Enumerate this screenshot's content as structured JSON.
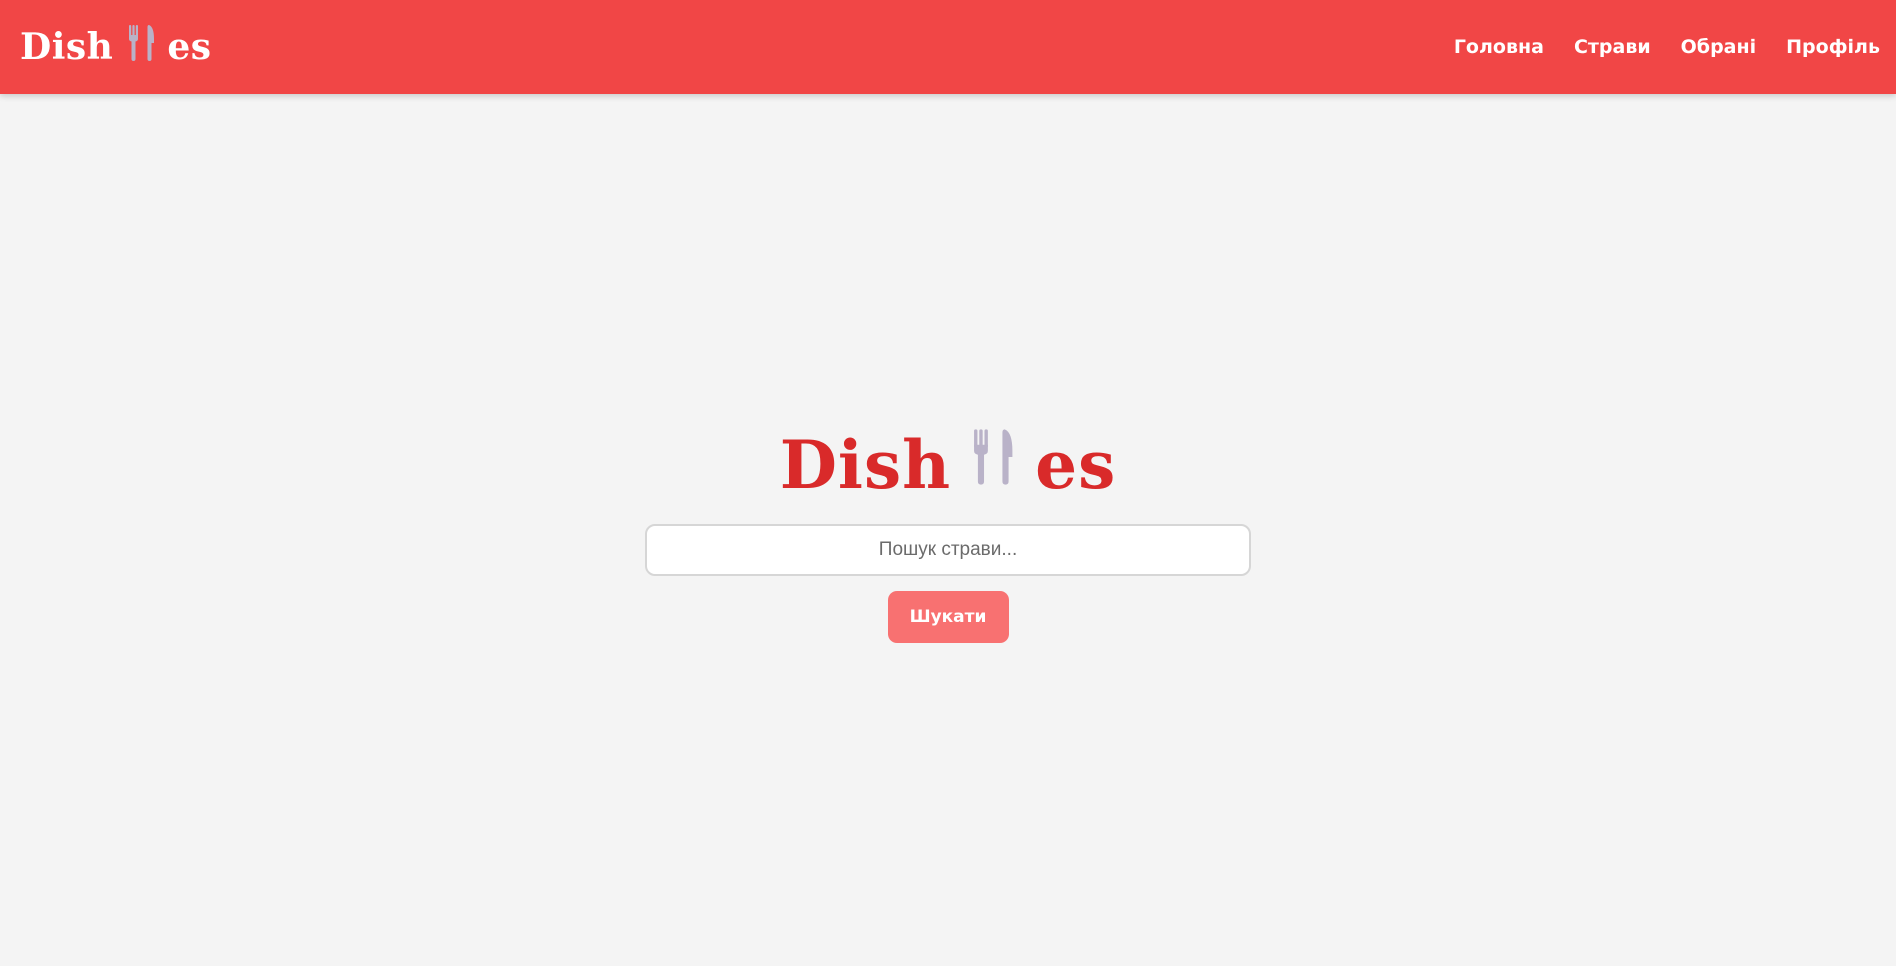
{
  "brand": {
    "prefix": "Dish",
    "suffix": "es",
    "icon": "fork-and-knife-icon"
  },
  "nav": {
    "items": [
      {
        "label": "Головна"
      },
      {
        "label": "Страви"
      },
      {
        "label": "Обрані"
      },
      {
        "label": "Профіль"
      }
    ]
  },
  "search": {
    "placeholder": "Пошук страви...",
    "value": "",
    "button_label": "Шукати"
  },
  "colors": {
    "navbar": "#f14646",
    "page_background": "#f4f4f4",
    "hero_logo": "#d92a2a",
    "search_button": "#f87171",
    "cutlery": "#b9b2c8"
  }
}
